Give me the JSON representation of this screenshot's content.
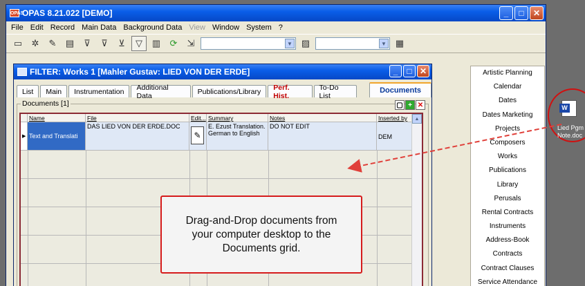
{
  "app": {
    "title": "OPAS 8.21.022  [DEMO]",
    "logo": "OPAS"
  },
  "menu": [
    "File",
    "Edit",
    "Record",
    "Main Data",
    "Background Data",
    "View",
    "Window",
    "System",
    "?"
  ],
  "inner_window": {
    "title": "FILTER: Works  1 [Mahler Gustav: LIED VON DER ERDE]"
  },
  "tabs": [
    "List",
    "Main",
    "Instrumentation",
    "Additional Data",
    "Publications/Library",
    "Perf. Hist.",
    "To-Do List",
    "Documents"
  ],
  "documents_group": {
    "label": "Documents [1]"
  },
  "grid": {
    "columns": [
      "Name",
      "File",
      "Edit...",
      "Summary",
      "Notes",
      "Inserted by"
    ],
    "row": {
      "name": "Text and Translati",
      "file": "DAS LIED VON DER ERDE.DOC",
      "summary": "E. Ezust Translation. German to English",
      "notes": "DO NOT EDIT",
      "inserted_by": "DEM"
    }
  },
  "right_panel": [
    "Artistic Planning",
    "Calendar",
    "Dates",
    "Dates Marketing",
    "Projects",
    "Composers",
    "Works",
    "Publications",
    "Library",
    "Perusals",
    "Rental Contracts",
    "Instruments",
    "Address-Book",
    "Contracts",
    "Contract Clauses",
    "Service Attendance"
  ],
  "desktop_icon": {
    "label_line1": "Lied Pgm",
    "label_line2": "Note.doc",
    "glyph": "W"
  },
  "callout": "Drag-and-Drop documents from your computer desktop to the Documents grid.",
  "colors": {
    "accent_red": "#d51b1b",
    "title_blue": "#0a5ee8",
    "selection_blue": "#316ac5"
  }
}
